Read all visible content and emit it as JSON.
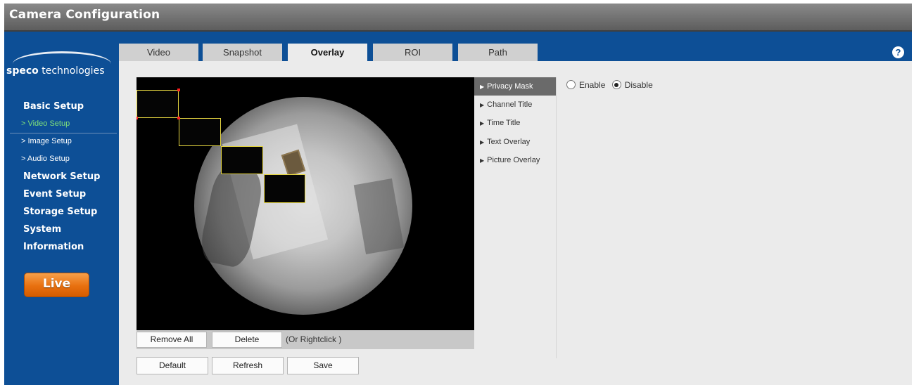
{
  "window": {
    "title": "Camera Configuration"
  },
  "brand": {
    "logo_bold": "speco",
    "logo_rest": " technologies"
  },
  "sidebar": {
    "sections": [
      {
        "label": "Basic Setup"
      },
      {
        "label": "Network Setup"
      },
      {
        "label": "Event Setup"
      },
      {
        "label": "Storage Setup"
      },
      {
        "label": "System"
      },
      {
        "label": "Information"
      }
    ],
    "basic_sub": [
      {
        "label": "> Video Setup",
        "active": true
      },
      {
        "label": "> Image Setup",
        "active": false
      },
      {
        "label": "> Audio Setup",
        "active": false
      }
    ],
    "live_label": "Live"
  },
  "tabs": [
    {
      "label": "Video",
      "active": false
    },
    {
      "label": "Snapshot",
      "active": false
    },
    {
      "label": "Overlay",
      "active": true
    },
    {
      "label": "ROI",
      "active": false
    },
    {
      "label": "Path",
      "active": false
    }
  ],
  "help": {
    "icon": "question-circle-icon",
    "glyph": "?"
  },
  "video_controls": {
    "remove_all": "Remove All",
    "delete": "Delete",
    "hint": "(Or Rightclick )"
  },
  "overlay_menu": [
    {
      "label": "Privacy Mask",
      "active": true
    },
    {
      "label": "Channel Title",
      "active": false
    },
    {
      "label": "Time Title",
      "active": false
    },
    {
      "label": "Text Overlay",
      "active": false
    },
    {
      "label": "Picture Overlay",
      "active": false
    }
  ],
  "privacy_mask": {
    "enable_label": "Enable",
    "disable_label": "Disable",
    "selected": "Disable"
  },
  "footer_buttons": {
    "default": "Default",
    "refresh": "Refresh",
    "save": "Save"
  },
  "colors": {
    "frame_blue": "#0d4f96",
    "active_sub": "#7fe07a",
    "live_orange": "#e8700f",
    "mask_border": "#e6d640"
  }
}
